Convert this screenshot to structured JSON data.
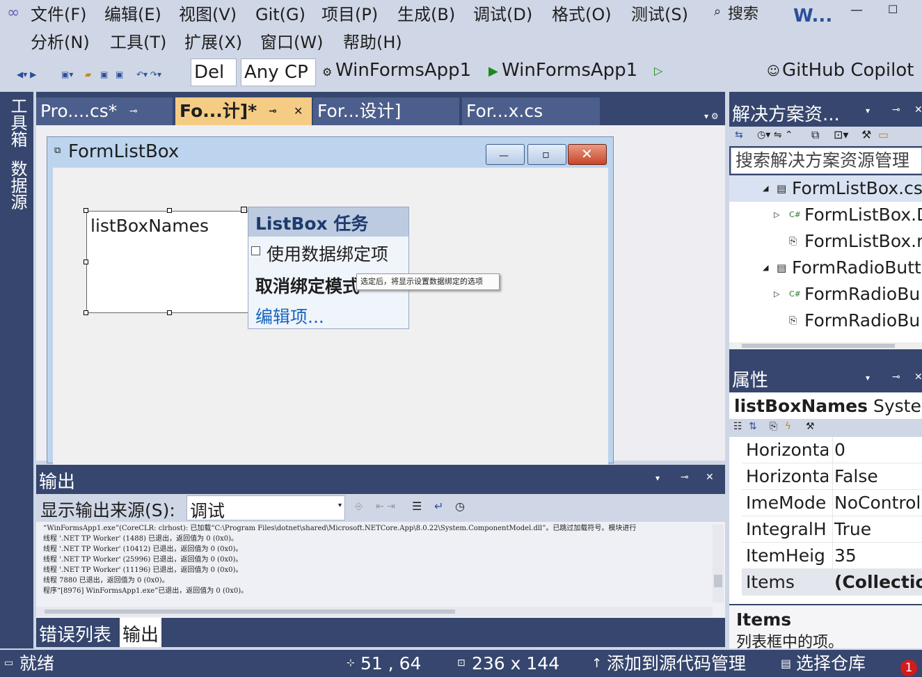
{
  "menu": {
    "row1": [
      "文件(F)",
      "编辑(E)",
      "视图(V)",
      "Git(G)",
      "项目(P)",
      "生成(B)",
      "调试(D)",
      "格式(O)",
      "测试(S)"
    ],
    "row2": [
      "分析(N)",
      "工具(T)",
      "扩展(X)",
      "窗口(W)",
      "帮助(H)"
    ],
    "search_label": "搜索",
    "window_title": "W..."
  },
  "toolbar": {
    "config": "Del",
    "platform": "Any CP",
    "startup_project": "WinFormsApp1",
    "run_target": "WinFormsApp1",
    "copilot": "GitHub Copilot"
  },
  "leftrail": {
    "toolbox": "工具箱",
    "datasources": "数据源"
  },
  "tabs": [
    {
      "label": "Pro....cs*"
    },
    {
      "label": "Fo...计]*"
    },
    {
      "label": "For...设计]"
    },
    {
      "label": "For...x.cs"
    }
  ],
  "designer": {
    "form_title": "FormListBox",
    "listbox_name": "listBoxNames",
    "task_panel": {
      "title": "ListBox 任务",
      "checkbox_label": "使用数据绑定项",
      "unbind_label": "取消绑定模式",
      "edit_items": "编辑项..."
    },
    "tooltip": "选定后，将显示设置数据绑定的选项"
  },
  "output": {
    "title": "输出",
    "source_label": "显示输出来源(S):",
    "source_value": "调试",
    "lines": [
      "“WinFormsApp1.exe”(CoreCLR: clrhost): 已加载“C:\\Program Files\\dotnet\\shared\\Microsoft.NETCore.App\\8.0.22\\System.ComponentModel.dll”。已跳过加载符号。模块进行",
      "线程 '.NET TP Worker' (1488) 已退出，返回值为 0 (0x0)。",
      "线程 '.NET TP Worker' (10412) 已退出，返回值为 0 (0x0)。",
      "线程 '.NET TP Worker' (25996) 已退出，返回值为 0 (0x0)。",
      "线程 '.NET TP Worker' (11196) 已退出，返回值为 0 (0x0)。",
      "线程 7880 已退出，返回值为 0 (0x0)。",
      "程序“[8976] WinFormsApp1.exe”已退出，返回值为 0 (0x0)。"
    ]
  },
  "bottom_tabs": {
    "error_list": "错误列表",
    "output": "输出"
  },
  "solution_explorer": {
    "title": "解决方案资...",
    "search_placeholder": "搜索解决方案资源管理",
    "items": [
      {
        "label": "FormListBox.cs",
        "icon": "form-icon"
      },
      {
        "label": "FormListBox.D",
        "icon": "csharp-icon"
      },
      {
        "label": "FormListBox.r",
        "icon": "resource-icon"
      },
      {
        "label": "FormRadioButt",
        "icon": "form-icon"
      },
      {
        "label": "FormRadioBu",
        "icon": "csharp-icon"
      },
      {
        "label": "FormRadioBu",
        "icon": "resource-icon"
      }
    ]
  },
  "properties": {
    "title": "属性",
    "object_name": "listBoxNames",
    "object_type": "Systen",
    "rows": [
      {
        "name": "Horizontal",
        "value": "0"
      },
      {
        "name": "Horizontal",
        "value": "False"
      },
      {
        "name": "ImeMode",
        "value": "NoControl"
      },
      {
        "name": "IntegralH",
        "value": "True"
      },
      {
        "name": "ItemHeig",
        "value": "35"
      },
      {
        "name": "Items",
        "value": "(Collection)"
      }
    ],
    "desc_title": "Items",
    "desc_text": "列表框中的项。"
  },
  "status": {
    "ready": "就绪",
    "position": "51 , 64",
    "size": "236 x 144",
    "add_source": "添加到源代码管理",
    "select_repo": "选择仓库",
    "notifications": "1"
  }
}
